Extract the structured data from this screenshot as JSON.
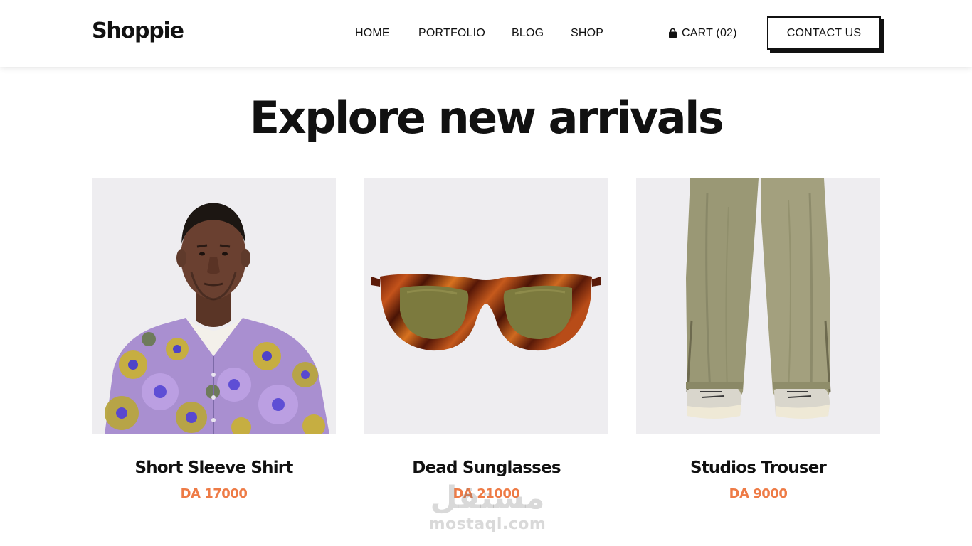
{
  "header": {
    "logo": "Shoppie",
    "nav": [
      {
        "label": "HOME"
      },
      {
        "label": "PORTFOLIO"
      },
      {
        "label": "BLOG"
      },
      {
        "label": "SHOP"
      }
    ],
    "cart_label": "CART (02)",
    "cart_icon": "shopping-bag-icon",
    "contact_label": "CONTACT US"
  },
  "section": {
    "title": "Explore new arrivals"
  },
  "products": [
    {
      "name": "Short Sleeve Shirt",
      "price": "DA 17000",
      "image": "model-floral-shirt-photo"
    },
    {
      "name": "Dead Sunglasses",
      "price": "DA 21000",
      "image": "tortoiseshell-sunglasses-photo"
    },
    {
      "name": "Studios Trouser",
      "price": "DA 9000",
      "image": "khaki-trousers-photo"
    }
  ],
  "watermark": {
    "arabic": "مستقل",
    "latin": "mostaql.com"
  },
  "colors": {
    "price": "#ee7b46",
    "image_bg": "#eeedf0",
    "text": "#111111"
  }
}
